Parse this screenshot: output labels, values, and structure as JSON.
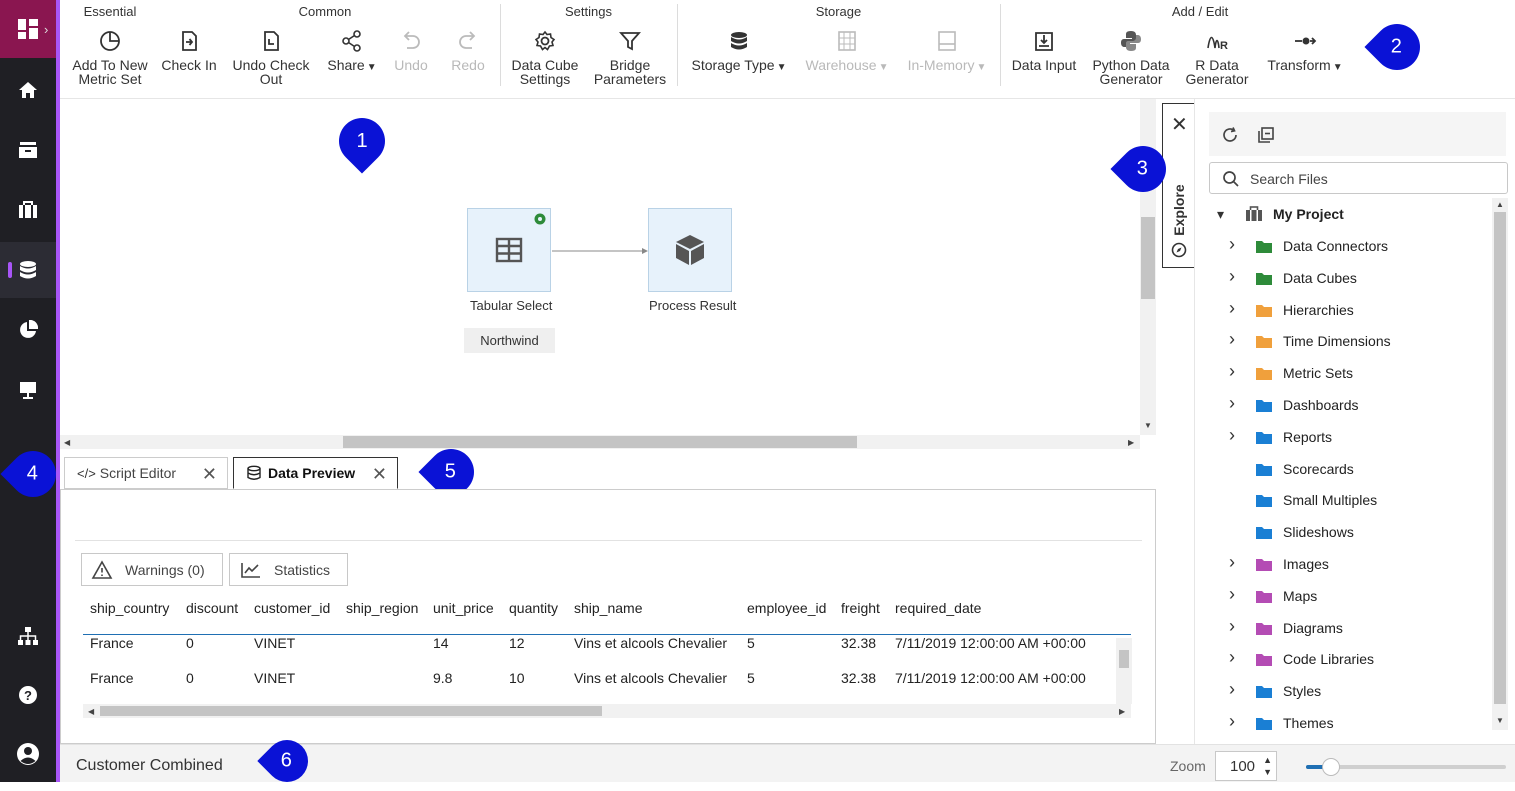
{
  "ribbon": {
    "groups": {
      "essential": "Essential",
      "common": "Common",
      "settings": "Settings",
      "storage": "Storage",
      "add_edit": "Add / Edit"
    },
    "buttons": {
      "add_metric_set": "Add To New\nMetric Set",
      "check_in": "Check In",
      "undo_checkout": "Undo Check\nOut",
      "share": "Share",
      "undo": "Undo",
      "redo": "Redo",
      "data_cube_settings": "Data Cube\nSettings",
      "bridge_parameters": "Bridge\nParameters",
      "storage_type": "Storage Type",
      "warehouse": "Warehouse",
      "in_memory": "In-Memory",
      "data_input": "Data Input",
      "python_gen": "Python Data\nGenerator",
      "r_gen": "R Data\nGenerator",
      "transform": "Transform"
    }
  },
  "canvas": {
    "nodes": {
      "tabular_select": "Tabular Select",
      "process_result": "Process Result"
    },
    "source_tag": "Northwind"
  },
  "markers": [
    "1",
    "2",
    "3",
    "4",
    "5",
    "6"
  ],
  "tabs": {
    "script_editor": "Script Editor",
    "data_preview": "Data Preview"
  },
  "preview": {
    "warnings": "Warnings (0)",
    "statistics": "Statistics",
    "columns": [
      "ship_country",
      "discount",
      "customer_id",
      "ship_region",
      "unit_price",
      "quantity",
      "ship_name",
      "employee_id",
      "freight",
      "required_date"
    ],
    "rows": [
      [
        "France",
        "0",
        "VINET",
        "",
        "14",
        "12",
        "Vins et alcools Chevalier",
        "5",
        "32.38",
        "7/11/2019 12:00:00 AM +00:00"
      ],
      [
        "France",
        "0",
        "VINET",
        "",
        "9.8",
        "10",
        "Vins et alcools Chevalier",
        "5",
        "32.38",
        "7/11/2019 12:00:00 AM +00:00"
      ]
    ]
  },
  "explore": {
    "tab_label": "Explore",
    "search_placeholder": "Search Files",
    "root": "My Project",
    "items": [
      {
        "label": "Data Connectors",
        "color": "#2e8b3a",
        "expandable": true
      },
      {
        "label": "Data Cubes",
        "color": "#2e8b3a",
        "expandable": true
      },
      {
        "label": "Hierarchies",
        "color": "#f0a03c",
        "expandable": true
      },
      {
        "label": "Time Dimensions",
        "color": "#f0a03c",
        "expandable": true
      },
      {
        "label": "Metric Sets",
        "color": "#f0a03c",
        "expandable": true
      },
      {
        "label": "Dashboards",
        "color": "#1a7fd4",
        "expandable": true
      },
      {
        "label": "Reports",
        "color": "#1a7fd4",
        "expandable": true
      },
      {
        "label": "Scorecards",
        "color": "#1a7fd4",
        "expandable": false
      },
      {
        "label": "Small Multiples",
        "color": "#1a7fd4",
        "expandable": false
      },
      {
        "label": "Slideshows",
        "color": "#1a7fd4",
        "expandable": false
      },
      {
        "label": "Images",
        "color": "#b44cb4",
        "expandable": true
      },
      {
        "label": "Maps",
        "color": "#b44cb4",
        "expandable": true
      },
      {
        "label": "Diagrams",
        "color": "#b44cb4",
        "expandable": true
      },
      {
        "label": "Code Libraries",
        "color": "#b44cb4",
        "expandable": true
      },
      {
        "label": "Styles",
        "color": "#1a7fd4",
        "expandable": true
      },
      {
        "label": "Themes",
        "color": "#1a7fd4",
        "expandable": true
      }
    ]
  },
  "status": {
    "title": "Customer Combined",
    "zoom_label": "Zoom",
    "zoom_value": "100",
    "zoom_fraction": 0.1
  },
  "colors": {
    "accent": "#a855f7",
    "marker": "#0a12d6",
    "brand": "#8a1650",
    "link": "#1f6fb3"
  }
}
